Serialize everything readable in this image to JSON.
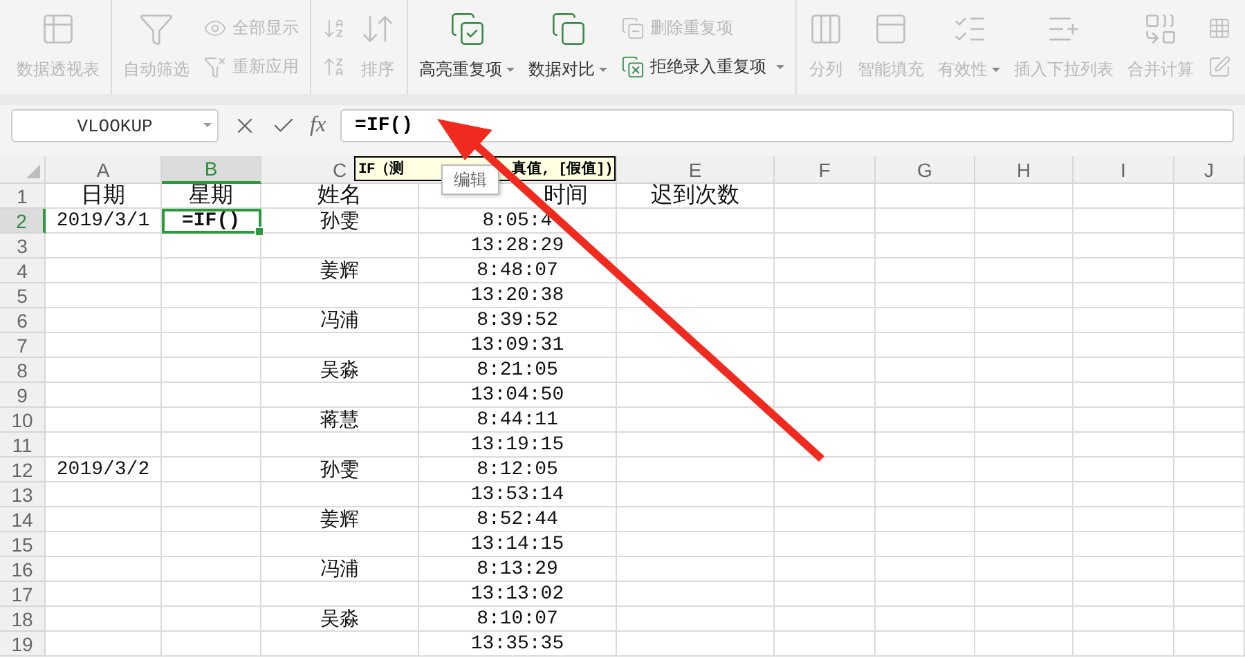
{
  "ribbon": {
    "groups": [
      {
        "items": [
          {
            "kind": "large",
            "label": "数据透视表",
            "disabled": true,
            "dropdown": false
          }
        ]
      },
      {
        "items": [
          {
            "kind": "large",
            "label": "自动筛选",
            "disabled": true,
            "dropdown": false
          },
          {
            "kind": "stack",
            "items": [
              {
                "label": "全部显示",
                "disabled": true,
                "dropdown": false
              },
              {
                "label": "重新应用",
                "disabled": true,
                "dropdown": false
              }
            ]
          }
        ]
      },
      {
        "items": [
          {
            "kind": "stack",
            "items": [
              {
                "disabled": true,
                "dropdown": false
              },
              {
                "disabled": true,
                "dropdown": false
              }
            ]
          },
          {
            "kind": "large",
            "label": "排序",
            "disabled": true,
            "dropdown": false
          }
        ]
      },
      {
        "items": [
          {
            "kind": "large",
            "label": "高亮重复项",
            "disabled": false,
            "dropdown": true
          },
          {
            "kind": "large",
            "label": "数据对比",
            "disabled": false,
            "dropdown": true
          },
          {
            "kind": "stack",
            "items": [
              {
                "label": "删除重复项",
                "disabled": true,
                "dropdown": false
              },
              {
                "label": "拒绝录入重复项",
                "disabled": false,
                "dropdown": true
              }
            ]
          }
        ]
      },
      {
        "items": [
          {
            "kind": "large",
            "label": "分列",
            "disabled": true,
            "dropdown": false
          },
          {
            "kind": "large",
            "label": "智能填充",
            "disabled": true,
            "dropdown": false
          },
          {
            "kind": "large",
            "label": "有效性",
            "disabled": true,
            "dropdown": true
          },
          {
            "kind": "large",
            "label": "插入下拉列表",
            "disabled": true,
            "dropdown": false
          },
          {
            "kind": "large",
            "label": "合并计算",
            "disabled": true,
            "dropdown": false
          },
          {
            "kind": "stack",
            "items": [
              {
                "disabled": true,
                "dropdown": false
              },
              {
                "disabled": true,
                "dropdown": false
              }
            ]
          }
        ]
      }
    ]
  },
  "formula_bar": {
    "name_box": "VLOOKUP",
    "function_label": "fx",
    "formula": "=IF()"
  },
  "tooltip": {
    "parts": [
      "IF（测",
      "真值, [假值])"
    ]
  },
  "popup": {
    "label": "编辑"
  },
  "sheet": {
    "columns": [
      {
        "label": "A",
        "selected": false
      },
      {
        "label": "B",
        "selected": true
      },
      {
        "label": "C",
        "selected": false
      },
      {
        "selected": false
      },
      {
        "label": "E",
        "selected": false
      },
      {
        "label": "F",
        "selected": false
      },
      {
        "label": "G",
        "selected": false
      },
      {
        "label": "H",
        "selected": false
      },
      {
        "label": "I",
        "selected": false
      },
      {
        "label": "J",
        "selected": false
      }
    ],
    "rows": [
      {
        "number": "1",
        "selected": false,
        "cells": [
          "日期",
          "星期",
          "姓名",
          "时间",
          "迟到次数"
        ]
      },
      {
        "number": "2",
        "selected": true,
        "cells": [
          "2019/3/1",
          "=IF()",
          "孙雯",
          "8:05:4",
          ""
        ]
      },
      {
        "number": "3",
        "selected": false,
        "cells": [
          "",
          "",
          "",
          "13:28:29",
          ""
        ]
      },
      {
        "number": "4",
        "selected": false,
        "cells": [
          "",
          "",
          "姜辉",
          "8:48:07",
          ""
        ]
      },
      {
        "number": "5",
        "selected": false,
        "cells": [
          "",
          "",
          "",
          "13:20:38",
          ""
        ]
      },
      {
        "number": "6",
        "selected": false,
        "cells": [
          "",
          "",
          "冯浦",
          "8:39:52",
          ""
        ]
      },
      {
        "number": "7",
        "selected": false,
        "cells": [
          "",
          "",
          "",
          "13:09:31",
          ""
        ]
      },
      {
        "number": "8",
        "selected": false,
        "cells": [
          "",
          "",
          "吴淼",
          "8:21:05",
          ""
        ]
      },
      {
        "number": "9",
        "selected": false,
        "cells": [
          "",
          "",
          "",
          "13:04:50",
          ""
        ]
      },
      {
        "number": "10",
        "selected": false,
        "cells": [
          "",
          "",
          "蒋慧",
          "8:44:11",
          ""
        ]
      },
      {
        "number": "11",
        "selected": false,
        "cells": [
          "",
          "",
          "",
          "13:19:15",
          ""
        ]
      },
      {
        "number": "12",
        "selected": false,
        "cells": [
          "2019/3/2",
          "",
          "孙雯",
          "8:12:05",
          ""
        ]
      },
      {
        "number": "13",
        "selected": false,
        "cells": [
          "",
          "",
          "",
          "13:53:14",
          ""
        ]
      },
      {
        "number": "14",
        "selected": false,
        "cells": [
          "",
          "",
          "姜辉",
          "8:52:44",
          ""
        ]
      },
      {
        "number": "15",
        "selected": false,
        "cells": [
          "",
          "",
          "",
          "13:14:15",
          ""
        ]
      },
      {
        "number": "16",
        "selected": false,
        "cells": [
          "",
          "",
          "冯浦",
          "8:13:29",
          ""
        ]
      },
      {
        "number": "17",
        "selected": false,
        "cells": [
          "",
          "",
          "",
          "13:13:02",
          ""
        ]
      },
      {
        "number": "18",
        "selected": false,
        "cells": [
          "",
          "",
          "吴淼",
          "8:10:07",
          ""
        ]
      },
      {
        "number": "19",
        "selected": false,
        "cells": [
          "",
          "",
          "",
          "13:35:35",
          ""
        ]
      }
    ]
  }
}
